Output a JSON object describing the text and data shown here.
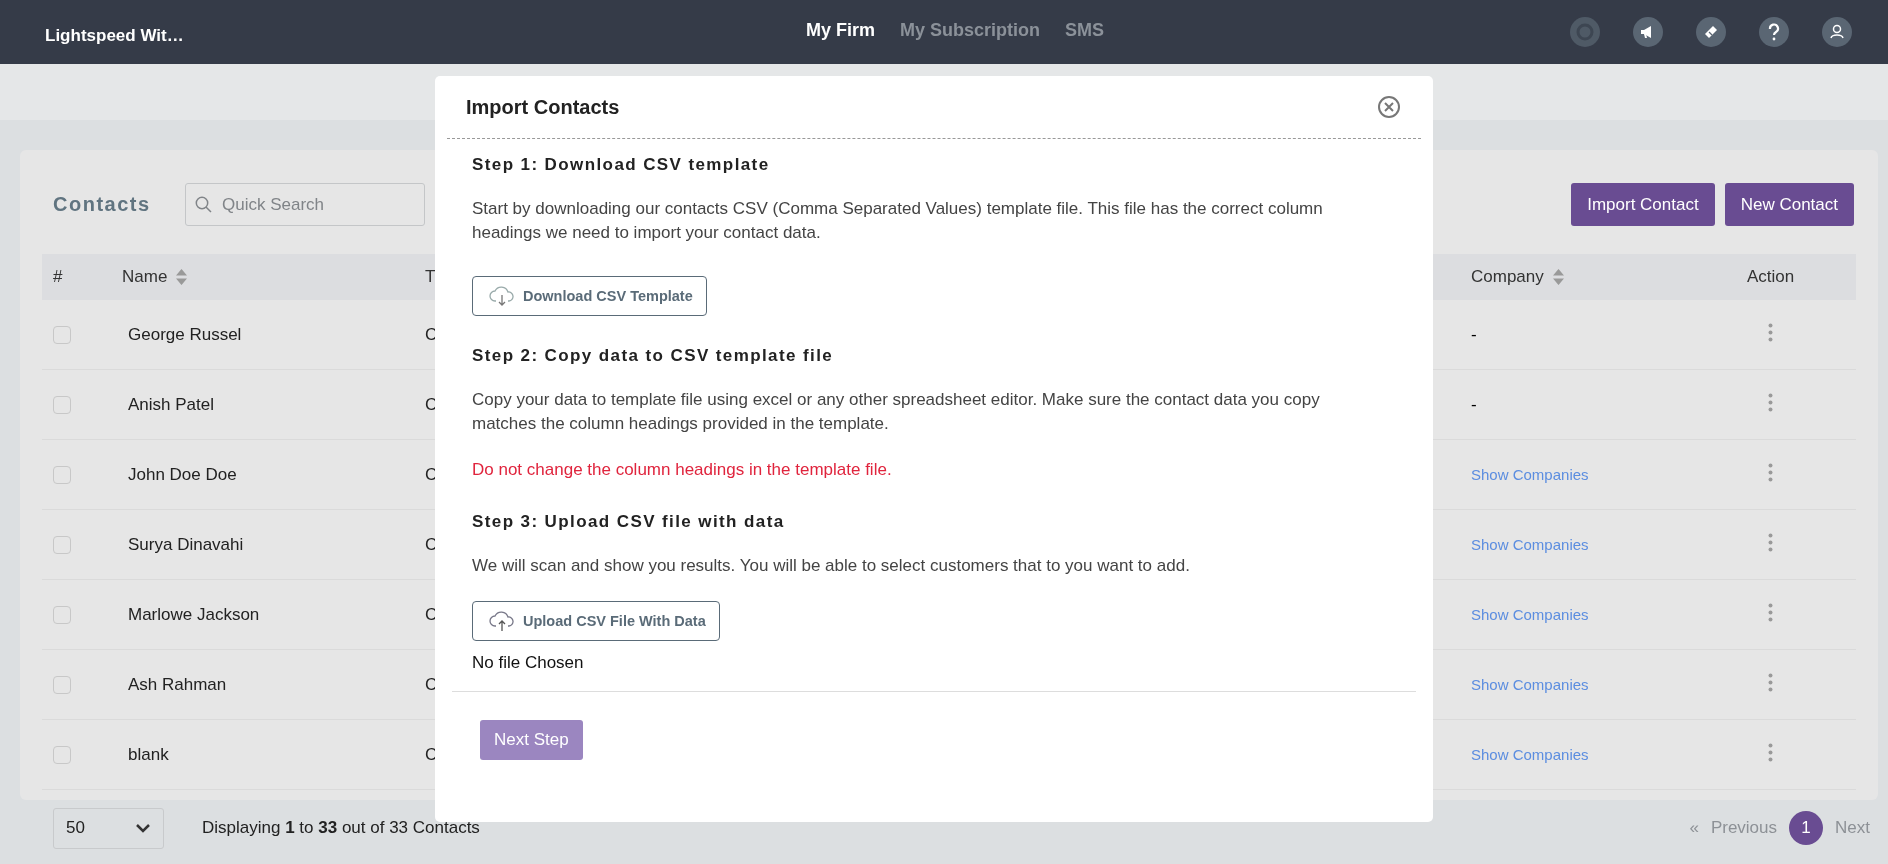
{
  "topbar": {
    "brand": "Lightspeed Wit…",
    "nav": [
      {
        "label": "My Firm",
        "selected": true
      },
      {
        "label": "My Subscription",
        "selected": false
      },
      {
        "label": "SMS",
        "selected": false
      }
    ]
  },
  "contacts": {
    "title": "Contacts",
    "search": {
      "placeholder": "Quick Search"
    },
    "buttons": [
      "Import Contact",
      "New Contact"
    ],
    "columns": [
      {
        "label": "#",
        "sortable": false
      },
      {
        "label": "Name",
        "sortable": true
      },
      {
        "label": "T",
        "sortable": false
      },
      {
        "label": "Company",
        "sortable": true
      },
      {
        "label": "Action",
        "sortable": false
      }
    ],
    "rows": [
      {
        "checked": false,
        "name": "George Russel",
        "column_3": "C",
        "company": {
          "text": "-",
          "kind": "text"
        }
      },
      {
        "checked": false,
        "name": "Anish Patel",
        "column_3": "C",
        "company": {
          "text": "-",
          "kind": "text"
        }
      },
      {
        "checked": false,
        "name": "John Doe Doe",
        "column_3": "C",
        "company": {
          "text": "Show Companies",
          "kind": "link"
        }
      },
      {
        "checked": false,
        "name": "Surya Dinavahi",
        "column_3": "C",
        "company": {
          "text": "Show Companies",
          "kind": "link"
        }
      },
      {
        "checked": false,
        "name": "Marlowe Jackson",
        "column_3": "C",
        "company": {
          "text": "Show Companies",
          "kind": "link"
        }
      },
      {
        "checked": false,
        "name": "Ash Rahman",
        "column_3": "C",
        "company": {
          "text": "Show Companies",
          "kind": "link"
        }
      },
      {
        "checked": false,
        "name": "blank",
        "column_3": "C",
        "company": {
          "text": "Show Companies",
          "kind": "link"
        }
      }
    ]
  },
  "footer": {
    "page_size": "50",
    "summary": "Displaying **1** to **33** out of 33 Contacts",
    "pagination": [
      {
        "label": "«",
        "kind": "arrow",
        "selected": false
      },
      {
        "label": "Previous",
        "kind": "link",
        "selected": false
      },
      {
        "label": "1",
        "kind": "page",
        "selected": true
      },
      {
        "label": "Next",
        "kind": "link",
        "selected": false
      }
    ]
  },
  "modal": {
    "title": "Import Contacts",
    "steps": [
      {
        "title": "Step 1: Download CSV template",
        "text": "Start by downloading our contacts CSV (Comma Separated Values) template file. This file has the correct column headings we need to import your contact data.",
        "button": {
          "label": "Download CSV Template",
          "kind": "download"
        }
      },
      {
        "title": "Step 2: Copy data to CSV template file",
        "text": "Copy your data to template file using excel or any other spreadsheet editor. Make sure the contact data you copy matches the column headings provided in the template.",
        "warning": "Do not change the column headings in the template file."
      },
      {
        "title": "Step 3: Upload CSV file with data",
        "text": "We will scan and show you results. You will be able to select customers that to you want to add.",
        "button": {
          "label": "Upload CSV File With Data",
          "kind": "upload"
        },
        "file_status": "No file Chosen"
      }
    ],
    "next_button": {
      "label": "Next Step",
      "disabled": true
    }
  }
}
